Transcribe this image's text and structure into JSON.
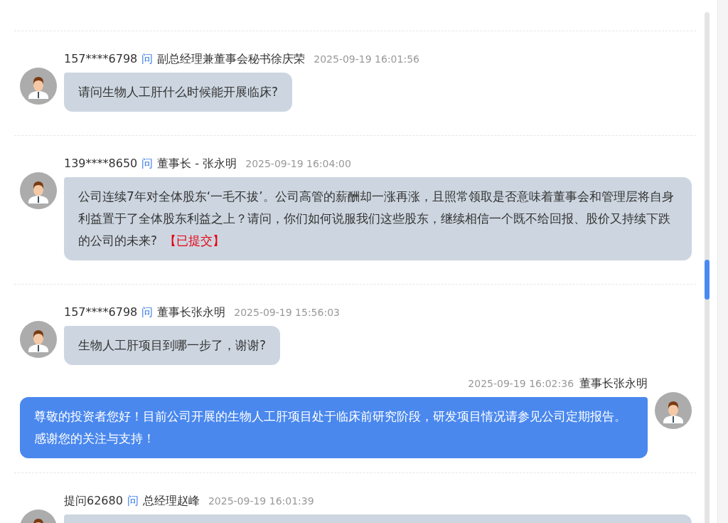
{
  "threads": [
    {
      "asker": "157****6798",
      "ask_word": "问",
      "recipient": "副总经理兼董事会秘书徐庆荣",
      "time": "2025-09-19 16:01:56",
      "question": "请问生物人工肝什么时候能开展临床?"
    },
    {
      "asker": "139****8650",
      "ask_word": "问",
      "recipient": "董事长 - 张永明",
      "time": "2025-09-19 16:04:00",
      "question": "公司连续7年对全体股东‘一毛不拔’。公司高管的薪酬却一涨再涨，且照常领取是否意味着董事会和管理层将自身利益置于了全体股东利益之上？请问，你们如何说服我们这些股东，继续相信一个既不给回报、股价又持续下跌的公司的未来?",
      "status": "【已提交】"
    },
    {
      "asker": "157****6798",
      "ask_word": "问",
      "recipient": "董事长张永明",
      "time": "2025-09-19 15:56:03",
      "question": "生物人工肝项目到哪一步了，谢谢?",
      "answer": {
        "time": "2025-09-19 16:02:36",
        "responder": "董事长张永明",
        "text": "尊敬的投资者您好！目前公司开展的生物人工肝项目处于临床前研究阶段，研发项目情况请参见公司定期报告。感谢您的关注与支持！"
      }
    },
    {
      "asker": "提问62680",
      "ask_word": "问",
      "recipient": "总经理赵峰",
      "time": "2025-09-19 16:01:39"
    }
  ]
}
